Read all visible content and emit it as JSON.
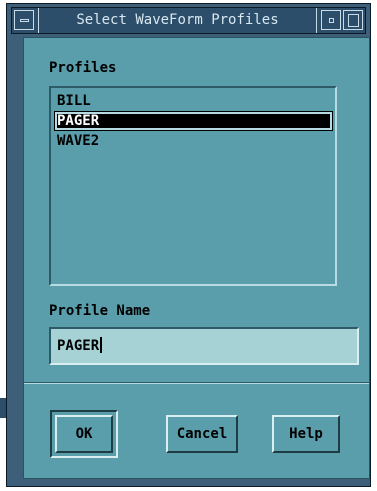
{
  "window": {
    "title": "Select WaveForm Profiles"
  },
  "profiles": {
    "label": "Profiles",
    "items": [
      "BILL",
      "PAGER",
      "WAVE2"
    ],
    "selected": "PAGER"
  },
  "profile_name": {
    "label": "Profile Name",
    "value": "PAGER"
  },
  "buttons": {
    "ok": "OK",
    "cancel": "Cancel",
    "help": "Help"
  },
  "colors": {
    "client_bg": "#5a9eac",
    "frame": "#3d5f7a",
    "titlebar": "#2c4e6a",
    "textfield_bg": "#a6d2d6",
    "selection": "#000000"
  }
}
